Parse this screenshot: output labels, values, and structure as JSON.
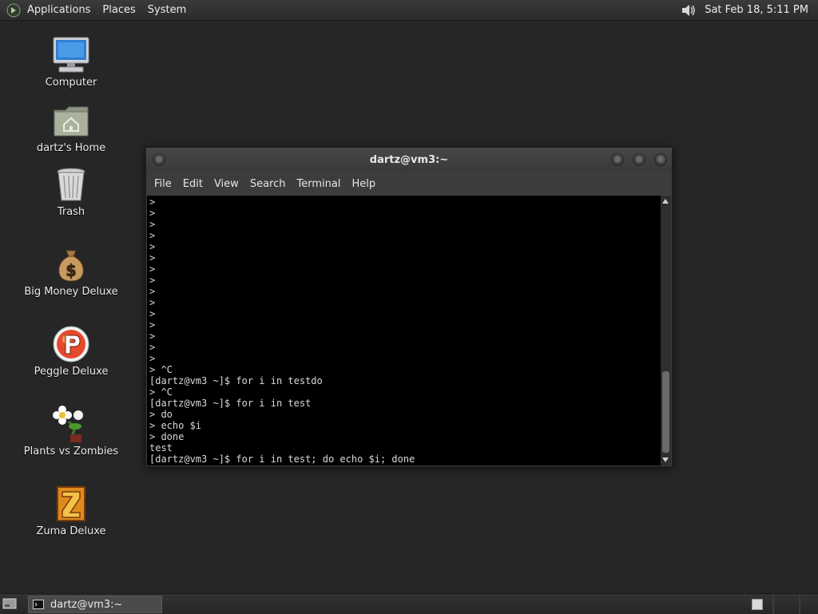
{
  "top_panel": {
    "menus": [
      "Applications",
      "Places",
      "System"
    ],
    "clock": "Sat Feb 18,  5:11 PM",
    "icons": {
      "logo": "gnome-foot-icon",
      "volume": "volume-icon"
    }
  },
  "desktop": {
    "icons": [
      {
        "label": "Computer",
        "icon": "computer-icon"
      },
      {
        "label": "dartz's Home",
        "icon": "home-folder-icon"
      },
      {
        "label": "Trash",
        "icon": "trash-icon"
      },
      {
        "label": "Big Money Deluxe",
        "icon": "money-bag-icon"
      },
      {
        "label": "Peggle Deluxe",
        "icon": "peggle-icon"
      },
      {
        "label": "Plants vs Zombies",
        "icon": "plants-vs-zombies-icon"
      },
      {
        "label": "Zuma Deluxe",
        "icon": "zuma-icon"
      }
    ]
  },
  "terminal": {
    "title": "dartz@vm3:~",
    "menu": [
      "File",
      "Edit",
      "View",
      "Search",
      "Terminal",
      "Help"
    ],
    "lines": [
      ">",
      ">",
      ">",
      ">",
      ">",
      ">",
      ">",
      ">",
      ">",
      ">",
      ">",
      ">",
      ">",
      ">",
      ">",
      "> ^C",
      "[dartz@vm3 ~]$ for i in testdo",
      "> ^C",
      "[dartz@vm3 ~]$ for i in test",
      "> do",
      "> echo $i",
      "> done",
      "test",
      "[dartz@vm3 ~]$ for i in test; do echo $i; done"
    ]
  },
  "bottom_panel": {
    "task_label": "dartz@vm3:~"
  },
  "colors": {
    "desktop_bg": "#262626",
    "terminal_bg": "#000000",
    "terminal_fg": "#d9d9d9"
  }
}
